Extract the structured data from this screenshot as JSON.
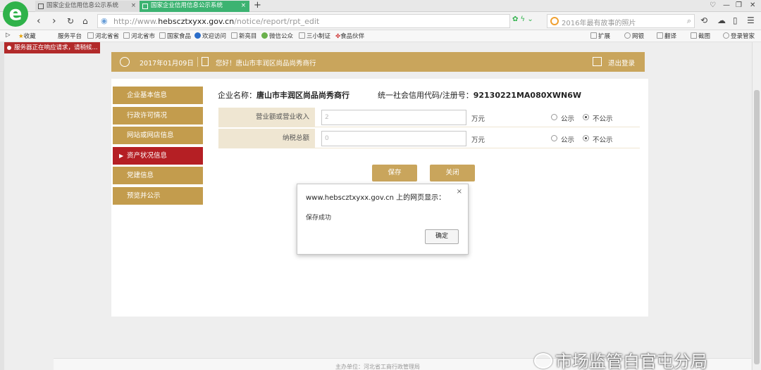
{
  "browser": {
    "tabs": [
      {
        "title": "国家企业信用信息公示系统",
        "active": false
      },
      {
        "title": "国家企业信用信息公示系统",
        "active": true
      }
    ],
    "url_prefix": "http://www.",
    "url_domain": "hebscztxyxx.gov.cn",
    "url_path": "/notice/report/rpt_edit",
    "search_placeholder": "2016年最有故事的照片",
    "bookmarks": [
      "收藏",
      "服务平台",
      "河北省省",
      "河北省市",
      "国家食品",
      "欢迎访问",
      "新亮目",
      "微信公众",
      "三小制证",
      "食品伙伴"
    ],
    "right_tools": [
      "扩展",
      "网银",
      "翻译",
      "截图",
      "登录管家"
    ],
    "notice": "服务器正在响应请求，请稍候..."
  },
  "header": {
    "date": "2017年01月09日",
    "welcome": "您好！唐山市丰润区尚品尚秀商行",
    "logout": "退出登录"
  },
  "sidebar": {
    "items": [
      {
        "label": "企业基本信息",
        "active": false
      },
      {
        "label": "行政许可情况",
        "active": false
      },
      {
        "label": "网站或网店信息",
        "active": false
      },
      {
        "label": "资产状况信息",
        "active": true
      },
      {
        "label": "党建信息",
        "active": false
      },
      {
        "label": "预览并公示",
        "active": false
      }
    ]
  },
  "company": {
    "name_label": "企业名称：",
    "name": "唐山市丰润区尚品尚秀商行",
    "credit_label": "统一社会信用代码/注册号：",
    "credit_code": "92130221MA080XWN6W"
  },
  "form": {
    "rows": [
      {
        "label": "营业额或营业收入",
        "value": "2",
        "unit": "万元",
        "opt_public": "公示",
        "opt_private": "不公示"
      },
      {
        "label": "纳税总额",
        "value": "0",
        "unit": "万元",
        "opt_public": "公示",
        "opt_private": "不公示"
      }
    ],
    "save": "保存",
    "close": "关闭"
  },
  "dialog": {
    "title": "www.hebscztxyxx.gov.cn 上的网页显示：",
    "close": "×",
    "message": "保存成功",
    "ok": "确定"
  },
  "footer": {
    "text": "主办单位：河北省工商行政管理局"
  },
  "watermark": "市场监管白官屯分局"
}
